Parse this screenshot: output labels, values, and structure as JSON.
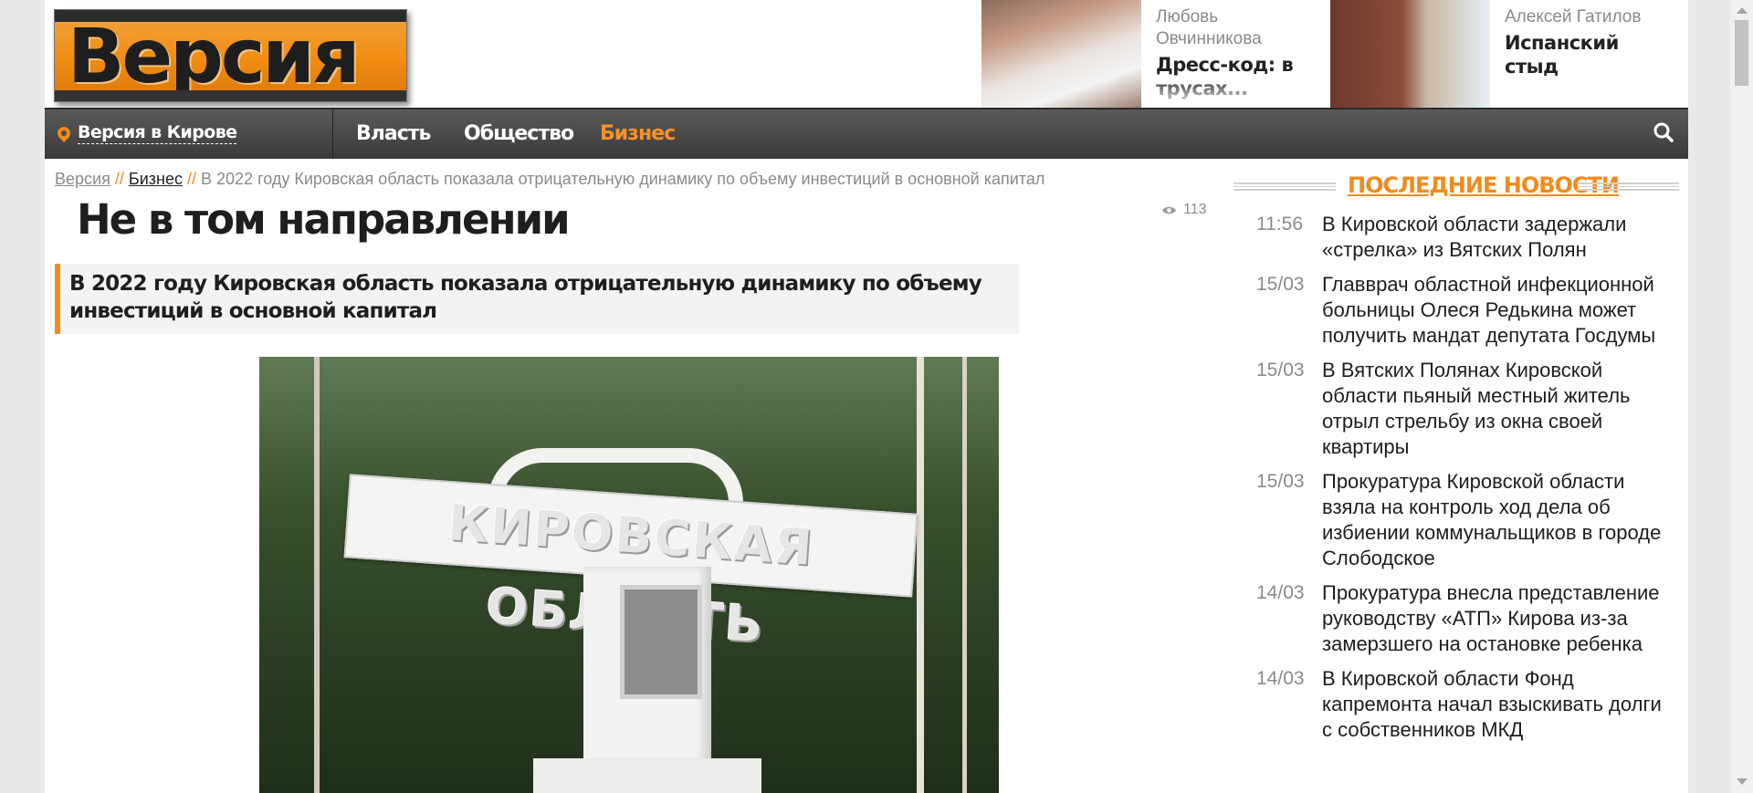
{
  "header": {
    "logo_text": "Версия",
    "promos": [
      {
        "author": "Любовь Овчинникова",
        "title": "Дресс-код: в трусах..."
      },
      {
        "author": "Алексей Гатилов",
        "title": "Испанский стыд"
      }
    ]
  },
  "nav": {
    "city_label": "Версия в Кирове",
    "items": [
      {
        "label": "Власть",
        "active": false
      },
      {
        "label": "Общество",
        "active": false
      },
      {
        "label": "Бизнес",
        "active": true
      }
    ],
    "search_icon": "search-icon",
    "accent_color": "#f28b1c"
  },
  "breadcrumb": {
    "home": "Версия",
    "section": "Бизнес",
    "separator": "//",
    "current": "В 2022 году Кировская область показала отрицательную динамику по объему инвестиций в основной капитал"
  },
  "article": {
    "views": "113",
    "title": "Не в том направлении",
    "lead": "В 2022 году Кировская область показала отрицательную динамику по объему инвестиций в основной капитал",
    "photo_sign_text": "КИРОВСКАЯ ОБЛАСТЬ"
  },
  "sidebar": {
    "title": "ПОСЛЕДНИЕ НОВОСТИ",
    "news": [
      {
        "time": "11:56",
        "text": "В Кировской области задержали «стрелка» из Вятских Полян"
      },
      {
        "time": "15/03",
        "text": "Главврач областной инфекционной больницы Олеся Редькина может получить мандат депутата Госдумы"
      },
      {
        "time": "15/03",
        "text": "В Вятских Полянах Кировской области пьяный местный житель отрыл стрельбу из окна своей квартиры"
      },
      {
        "time": "15/03",
        "text": "Прокуратура Кировской области взяла на контроль ход дела об избиении коммунальщиков в городе Слободское"
      },
      {
        "time": "14/03",
        "text": "Прокуратура внесла представление руководству «АТП» Кирова из-за замерзшего на остановке ребенка"
      },
      {
        "time": "14/03",
        "text": "В Кировской области Фонд капремонта начал взыскивать долги с собственников МКД"
      }
    ]
  }
}
